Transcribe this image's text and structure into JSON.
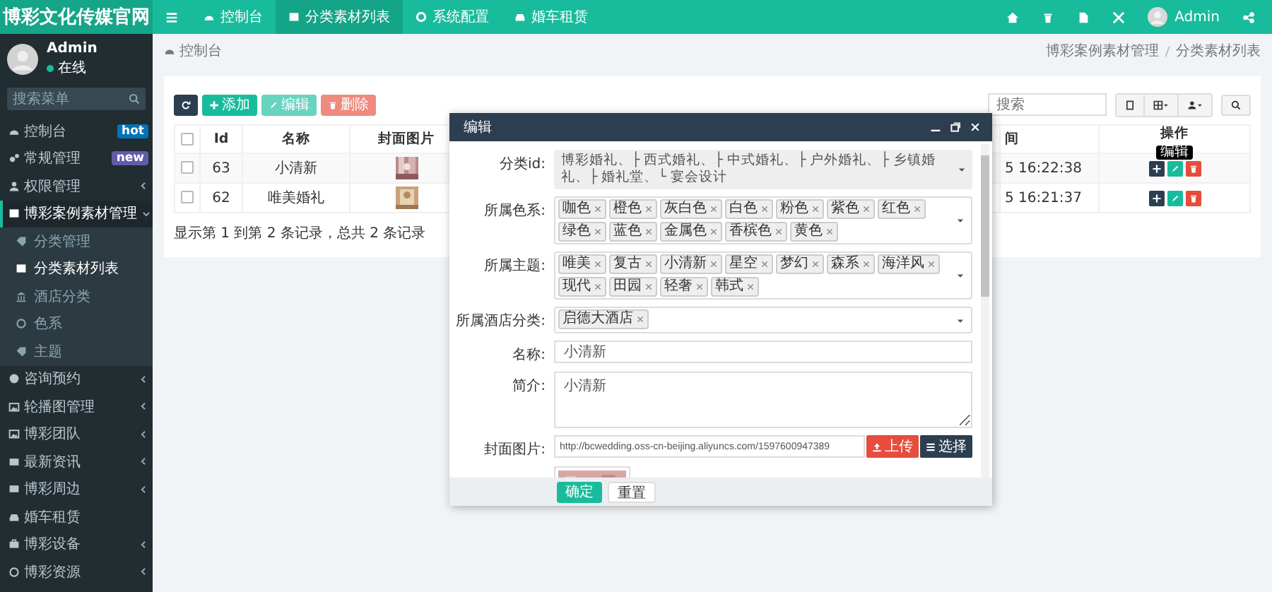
{
  "header": {
    "logo": "博彩文化传媒官网",
    "nav": [
      {
        "label": "控制台",
        "selected": false
      },
      {
        "label": "分类素材列表",
        "selected": true
      },
      {
        "label": "系统配置",
        "selected": false
      },
      {
        "label": "婚车租赁",
        "selected": false
      }
    ],
    "user": "Admin"
  },
  "sidebar": {
    "user": {
      "name": "Admin",
      "status": "在线"
    },
    "search": {
      "placeholder": "搜索菜单"
    },
    "items": [
      {
        "kind": "link",
        "label": "控制台",
        "badge": "hot",
        "color": "#0073b7",
        "selected": false
      },
      {
        "kind": "link",
        "label": "常规管理",
        "badge": "new",
        "color": "#605ca8",
        "selected": false
      },
      {
        "kind": "group",
        "label": "权限管理",
        "expanded": false,
        "selected": false
      },
      {
        "kind": "group",
        "label": "博彩案例素材管理",
        "expanded": true,
        "selected": true,
        "children": [
          {
            "label": "分类管理",
            "selected": false
          },
          {
            "label": "分类素材列表",
            "selected": true
          },
          {
            "label": "酒店分类",
            "selected": false
          },
          {
            "label": "色系",
            "selected": false
          },
          {
            "label": "主题",
            "selected": false
          }
        ]
      },
      {
        "kind": "group",
        "label": "咨询预约",
        "expanded": false,
        "selected": false
      },
      {
        "kind": "group",
        "label": "轮播图管理",
        "expanded": false,
        "selected": false
      },
      {
        "kind": "group",
        "label": "博彩团队",
        "expanded": false,
        "selected": false
      },
      {
        "kind": "group",
        "label": "最新资讯",
        "expanded": false,
        "selected": false
      },
      {
        "kind": "group",
        "label": "博彩周边",
        "expanded": false,
        "selected": false
      },
      {
        "kind": "link",
        "label": "婚车租赁",
        "selected": false
      },
      {
        "kind": "group",
        "label": "博彩设备",
        "expanded": false,
        "selected": false
      },
      {
        "kind": "group",
        "label": "博彩资源",
        "expanded": false,
        "selected": false
      }
    ]
  },
  "breadcrumb": {
    "title": "控制台",
    "path": [
      "博彩案例素材管理",
      "分类素材列表"
    ]
  },
  "toolbar": {
    "buttons": [
      {
        "kind": "refresh",
        "disabled": false
      },
      {
        "kind": "add",
        "label": "添加",
        "disabled": false
      },
      {
        "kind": "edit",
        "label": "编辑",
        "disabled": true
      },
      {
        "kind": "delete",
        "label": "删除",
        "disabled": true
      }
    ],
    "search": {
      "placeholder": "搜索"
    }
  },
  "table": {
    "select_all": {
      "checked": false
    },
    "columns": [
      "Id",
      "名称",
      "封面图片",
      "间",
      "操作"
    ],
    "rows": [
      {
        "checked": false,
        "id": "63",
        "name": "小清新",
        "time": "5 16:22:38"
      },
      {
        "checked": false,
        "id": "62",
        "name": "唯美婚礼",
        "time": "5 16:21:37"
      }
    ],
    "tooltip": "编辑",
    "summary": "显示第 1 到第 2 条记录，总共 2 条记录"
  },
  "modal": {
    "title": "编辑",
    "fields": [
      {
        "kind": "select",
        "label": "分类id:",
        "value": "博彩婚礼、├ 西式婚礼、├ 中式婚礼、├ 户外婚礼、├ 乡镇婚礼、├ 婚礼堂、└ 宴会设计"
      },
      {
        "kind": "tags",
        "label": "所属色系:",
        "tags": [
          "咖色",
          "橙色",
          "灰白色",
          "白色",
          "粉色",
          "紫色",
          "红色",
          "绿色",
          "蓝色",
          "金属色",
          "香槟色",
          "黄色"
        ]
      },
      {
        "kind": "tags",
        "label": "所属主题:",
        "tags": [
          "唯美",
          "复古",
          "小清新",
          "星空",
          "梦幻",
          "森系",
          "海洋风",
          "现代",
          "田园",
          "轻奢",
          "韩式"
        ]
      },
      {
        "kind": "tags",
        "label": "所属酒店分类:",
        "tags": [
          "启德大酒店"
        ]
      },
      {
        "kind": "input",
        "label": "名称:",
        "value": "小清新"
      },
      {
        "kind": "textarea",
        "label": "简介:",
        "value": "小清新"
      },
      {
        "kind": "file",
        "label": "封面图片:",
        "value": "http://bcwedding.oss-cn-beijing.aliyuncs.com/1597600947389",
        "upload": "上传",
        "choose": "选择"
      }
    ],
    "buttons": [
      {
        "kind": "primary",
        "label": "确定"
      },
      {
        "kind": "default",
        "label": "重置"
      }
    ]
  }
}
